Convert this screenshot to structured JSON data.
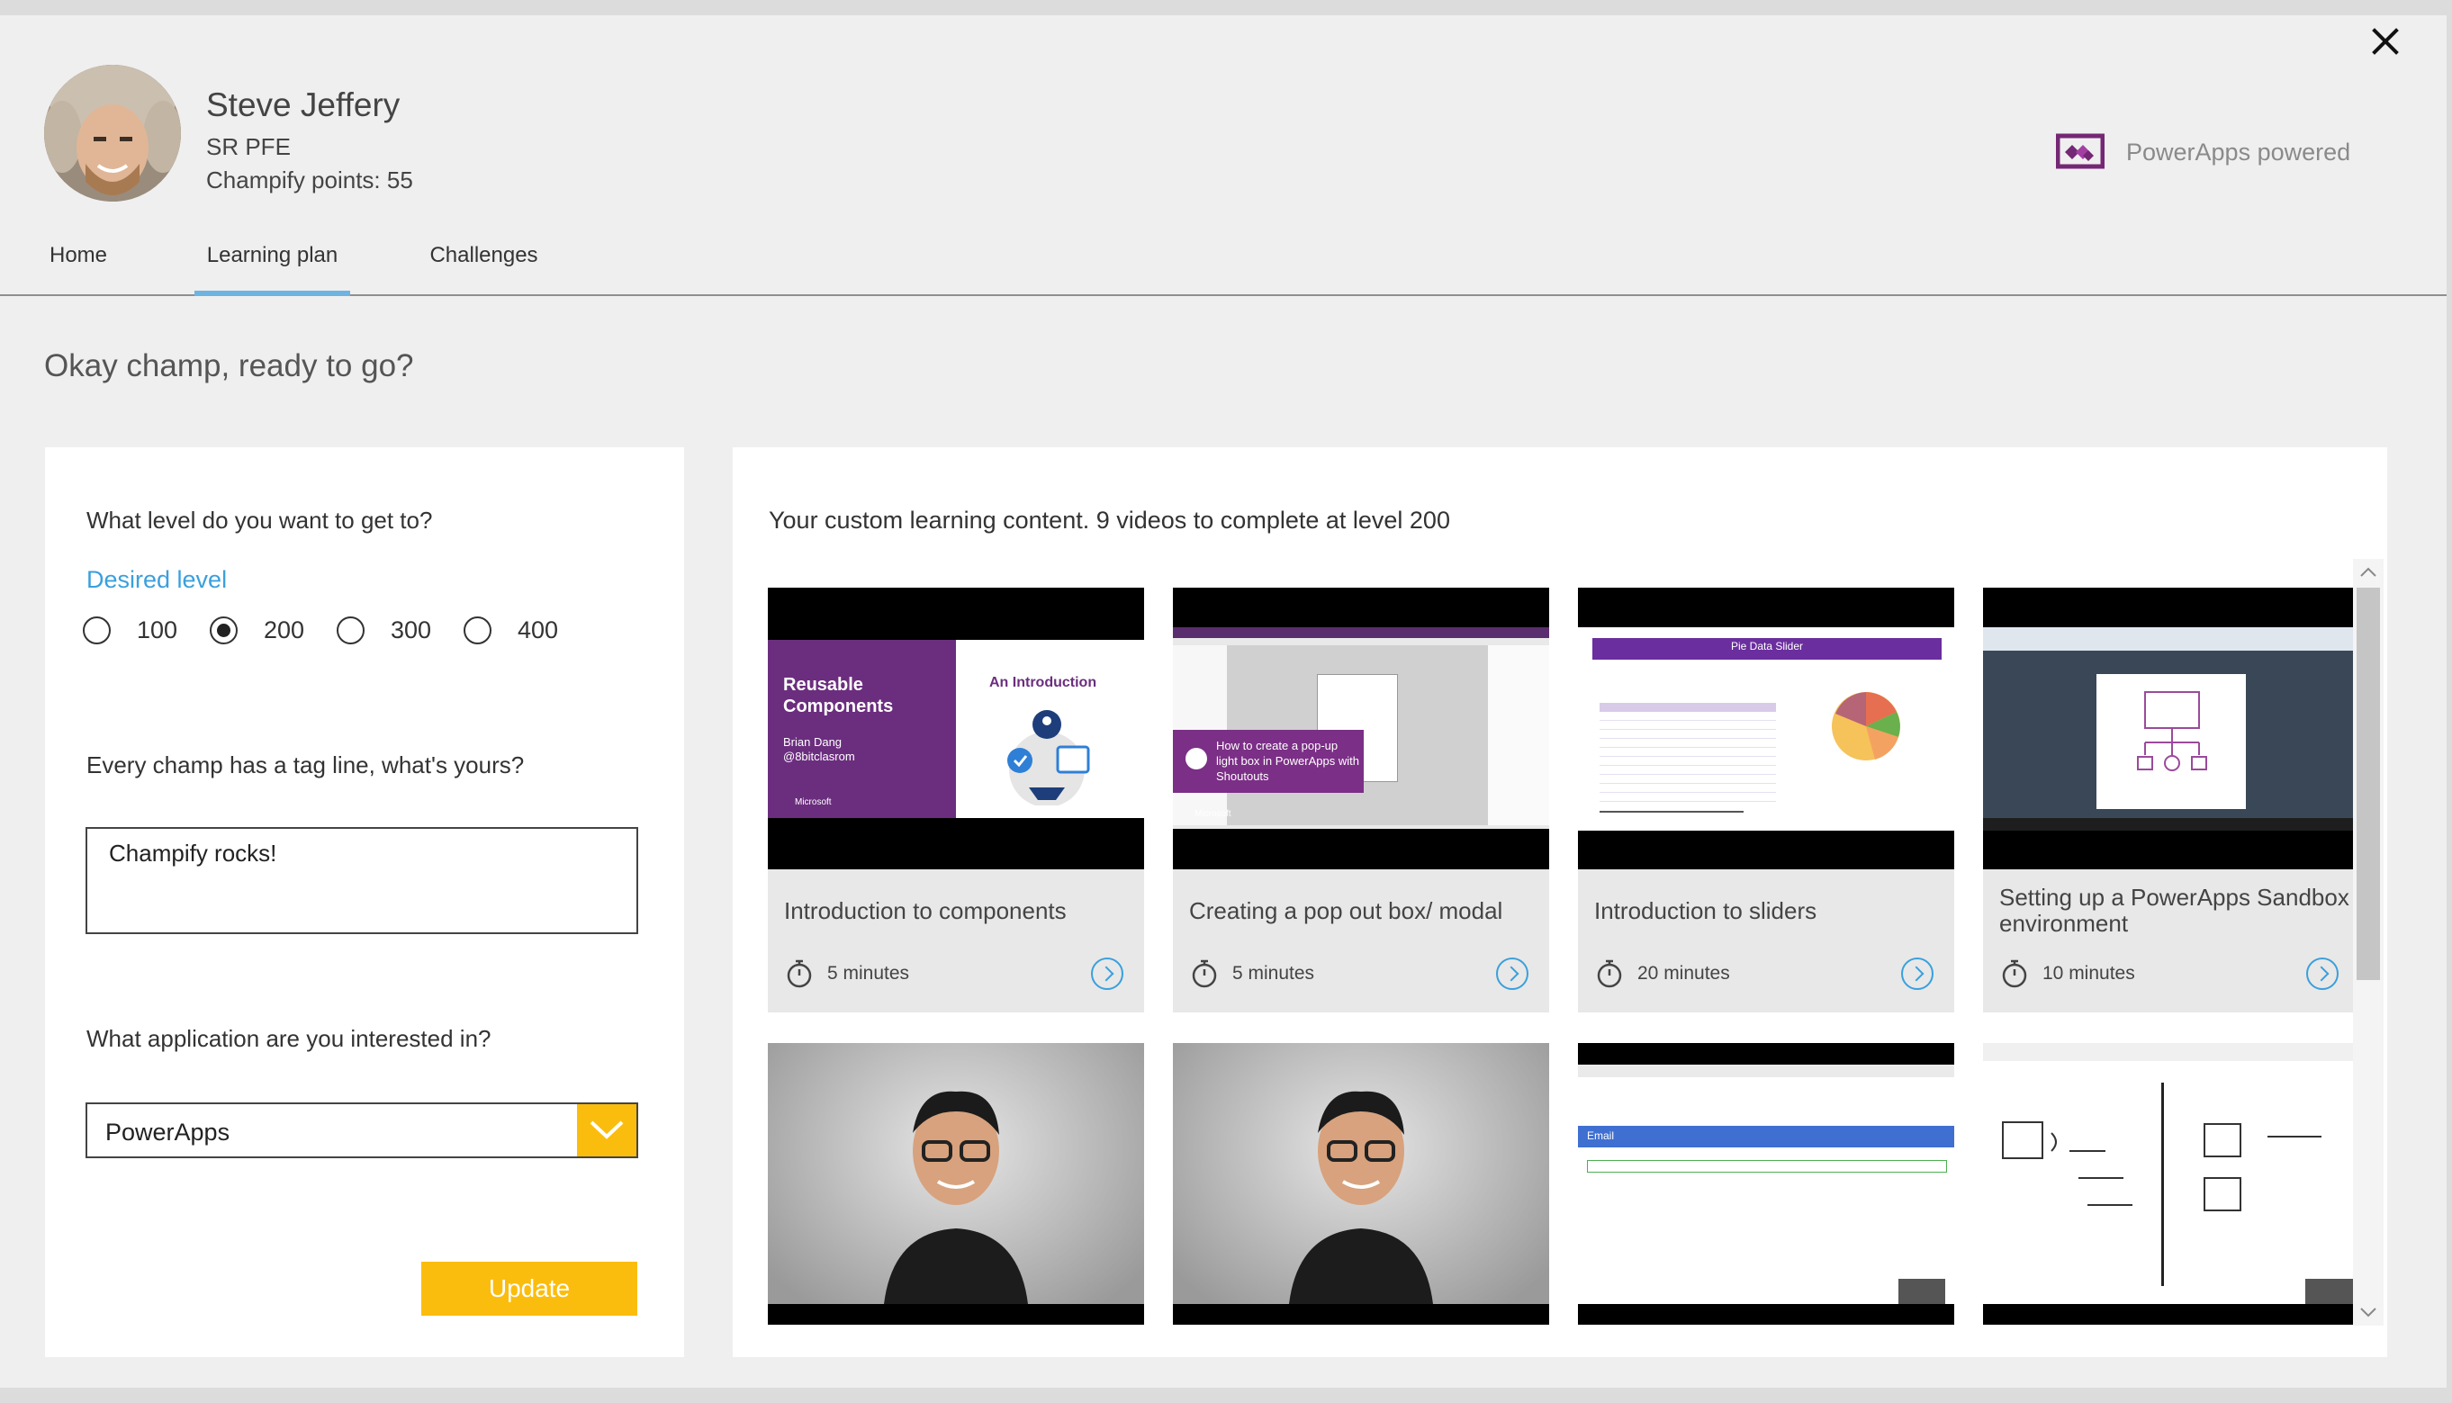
{
  "header": {
    "user_name": "Steve Jeffery",
    "user_role": "SR PFE",
    "user_points": "Champify points: 55",
    "powered_by": "PowerApps powered"
  },
  "tabs": [
    {
      "label": "Home",
      "active": false
    },
    {
      "label": "Learning plan",
      "active": true
    },
    {
      "label": "Challenges",
      "active": false
    }
  ],
  "greeting": "Okay champ, ready to go?",
  "left_panel": {
    "level_question": "What level do you want to get to?",
    "desired_level_label": "Desired level",
    "levels": [
      {
        "label": "100",
        "checked": false
      },
      {
        "label": "200",
        "checked": true
      },
      {
        "label": "300",
        "checked": false
      },
      {
        "label": "400",
        "checked": false
      }
    ],
    "tagline_question": "Every champ has a tag line, what's yours?",
    "tagline_value": "Champify rocks!",
    "application_question": "What application are you interested in?",
    "application_value": "PowerApps",
    "update_label": "Update"
  },
  "right_panel": {
    "title": "Your custom learning content. 9 videos to complete at level 200",
    "videos": [
      {
        "title": "Introduction to components",
        "duration": "5 minutes"
      },
      {
        "title": "Creating a pop out box/ modal",
        "duration": "5 minutes"
      },
      {
        "title": "Introduction to sliders",
        "duration": "20 minutes"
      },
      {
        "title": "Setting up a PowerApps Sandbox environment",
        "duration": "10 minutes"
      }
    ],
    "thumb_text": {
      "components_title": "Reusable Components",
      "components_author": "Brian Dang",
      "components_handle": "@8bitclasrom",
      "components_intro": "An Introduction",
      "ms_label": "Microsoft",
      "popup_caption": "How to create a pop-up light box in PowerApps with Shoutouts",
      "slider_header": "Pie Data Slider",
      "email_label": "Email"
    }
  },
  "colors": {
    "accent_blue": "#3aa0dc",
    "accent_yellow": "#fbbd0d",
    "powerapps_purple": "#742774"
  }
}
